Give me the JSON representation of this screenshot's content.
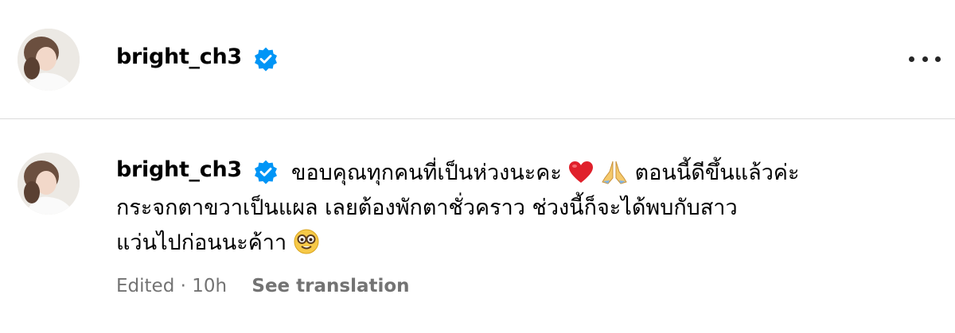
{
  "post": {
    "username": "bright_ch3",
    "verified": true
  },
  "comment": {
    "username": "bright_ch3",
    "line1": "ขอบคุณทุกคนที่เป็นห่วงนะคะ",
    "line1b": "ตอนนี้ดีขึ้นแล้วค่ะ",
    "line2": "กระจกตาขวาเป็นแผล เลยต้องพักตาชั่วคราว ช่วงนี้ก็จะได้พบกับสาว",
    "line3": "แว่นไปก่อนนะค้าา",
    "emoji_1": "red-heart",
    "emoji_2": "folded-hands",
    "emoji_3": "nerd-face",
    "edited": "Edited · 10h",
    "see_translation": "See translation"
  },
  "colors": {
    "verified_blue": "#0095f6",
    "meta_gray": "#737373",
    "divider": "#dbdbdb"
  }
}
